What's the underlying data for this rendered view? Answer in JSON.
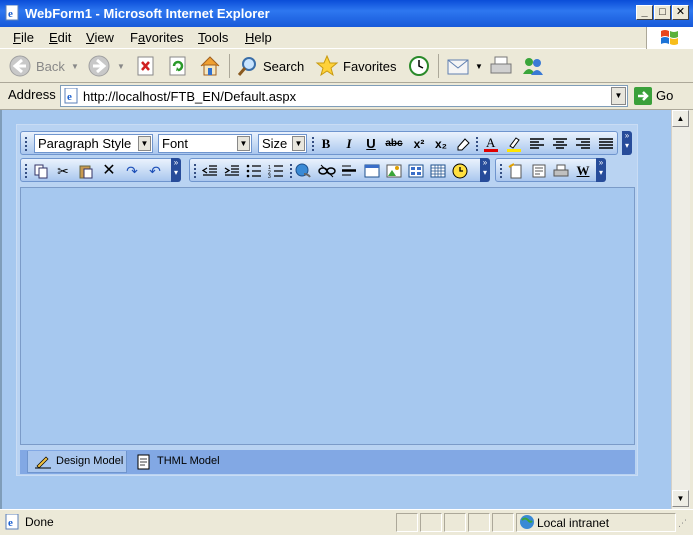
{
  "window": {
    "title": "WebForm1 - Microsoft Internet Explorer",
    "minimize": "_",
    "maximize": "□",
    "close": "✕"
  },
  "menu": {
    "items": [
      {
        "label": "File",
        "key": "F",
        "rest": "ile"
      },
      {
        "label": "Edit",
        "key": "E",
        "rest": "dit"
      },
      {
        "label": "View",
        "key": "V",
        "rest": "iew"
      },
      {
        "label": "Favorites",
        "key": "a",
        "pre": "F",
        "rest": "vorites"
      },
      {
        "label": "Tools",
        "key": "T",
        "rest": "ools"
      },
      {
        "label": "Help",
        "key": "H",
        "rest": "elp"
      }
    ]
  },
  "toolbar": {
    "back": "Back",
    "search": "Search",
    "favorites": "Favorites"
  },
  "address": {
    "label": "Address",
    "url": "http://localhost/FTB_EN/Default.aspx",
    "go": "Go"
  },
  "editor": {
    "paragraph_style": "Paragraph Style",
    "font": "Font",
    "size": "Size",
    "tabs": {
      "design": "Design Model",
      "html": "THML Model"
    }
  },
  "status": {
    "text": "Done",
    "zone": "Local intranet"
  },
  "colors": {
    "titlebar": "#0A4DD8",
    "content_bg": "#A6C8EF",
    "toolbar_blue": "#274C9A",
    "font_color_red": "#E00000",
    "highlight_yellow": "#FFE600"
  }
}
